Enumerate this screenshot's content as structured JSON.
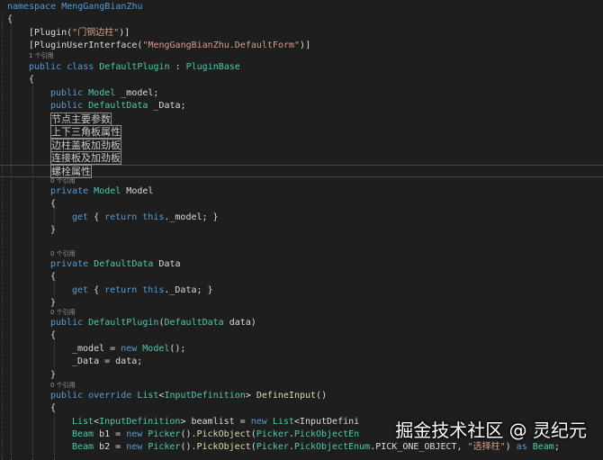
{
  "code": {
    "l1": "namespace MengGangBianZhu",
    "l2": "{",
    "l3_a": "[Plugin(",
    "l3_s": "\"门钢边柱\"",
    "l3_b": ")]",
    "l4_a": "[PluginUserInterface(",
    "l4_s": "\"MengGangBianZhu.DefaultForm\"",
    "l4_b": ")]",
    "hint_refs1": "1 个引用",
    "l5_kw": "public class ",
    "l5_ty": "DefaultPlugin",
    "l5_sep": " : ",
    "l5_base": "PluginBase",
    "l6": "{",
    "l7_kw": "public ",
    "l7_ty": "Model",
    "l7_id": " _model;",
    "l8_kw": "public ",
    "l8_ty": "DefaultData",
    "l8_id": " _Data;",
    "r1": "节点主要参数",
    "r2": "上下三角板属性",
    "r3": "边柱盖板加劲板",
    "r4": "连接板及加劲板",
    "r5": "螺栓属性",
    "hint_refs0a": "0 个引用",
    "l14_kw": "private ",
    "l14_ty": "Model",
    "l14_id": " Model",
    "l15": "{",
    "l16_kw1": "get",
    "l16_a": " { ",
    "l16_kw2": "return this",
    "l16_b": "._model; }",
    "l17": "}",
    "hint_refs0b": "0 个引用",
    "l19_kw": "private ",
    "l19_ty": "DefaultData",
    "l19_id": " Data",
    "l20": "{",
    "l21_kw1": "get",
    "l21_a": " { ",
    "l21_kw2": "return this",
    "l21_b": "._Data; }",
    "l22": "}",
    "hint_refs0c": "0 个引用",
    "l23_kw": "public ",
    "l23_ty": "DefaultPlugin",
    "l23_a": "(",
    "l23_ty2": "DefaultData",
    "l23_b": " data)",
    "l24": "{",
    "l25_a": "_model = ",
    "l25_kw": "new ",
    "l25_ty": "Model",
    "l25_b": "();",
    "l26": "_Data = data;",
    "l27": "}",
    "hint_refs0d": "0 个引用",
    "l28_kw": "public override ",
    "l28_ty": "List",
    "l28_a": "<",
    "l28_ty2": "InputDefinition",
    "l28_b": "> ",
    "l28_fn": "DefineInput",
    "l28_c": "()",
    "l29": "{",
    "l30_ty": "List",
    "l30_a": "<",
    "l30_ty2": "InputDefinition",
    "l30_b": "> ",
    "l30_id": "beamlist",
    "l30_c": " = ",
    "l30_kw": "new ",
    "l30_ty3": "List",
    "l30_d": "<InputDefini",
    "l31_ty": "Beam",
    "l31_id": " b1",
    "l31_a": " = ",
    "l31_kw": "new ",
    "l31_ty2": "Picker",
    "l31_b": "().",
    "l31_fn": "PickObject",
    "l31_c": "(",
    "l31_ty3": "Picker",
    "l31_d": ".",
    "l31_ty4": "PickObjectEn",
    "l32_ty": "Beam",
    "l32_id": " b2",
    "l32_a": " = ",
    "l32_kw": "new ",
    "l32_ty2": "Picker",
    "l32_b": "().",
    "l32_fn": "PickObject",
    "l32_c": "(",
    "l32_ty3": "Picker",
    "l32_d": ".",
    "l32_ty4": "PickObjectEnum",
    "l32_e": ".PICK_ONE_OBJECT, ",
    "l32_s": "\"选择柱\"",
    "l32_f": ") ",
    "l32_kw2": "as ",
    "l32_ty5": "Beam",
    "l32_g": ";"
  },
  "watermark": "掘金技术社区 @ 灵纪元"
}
